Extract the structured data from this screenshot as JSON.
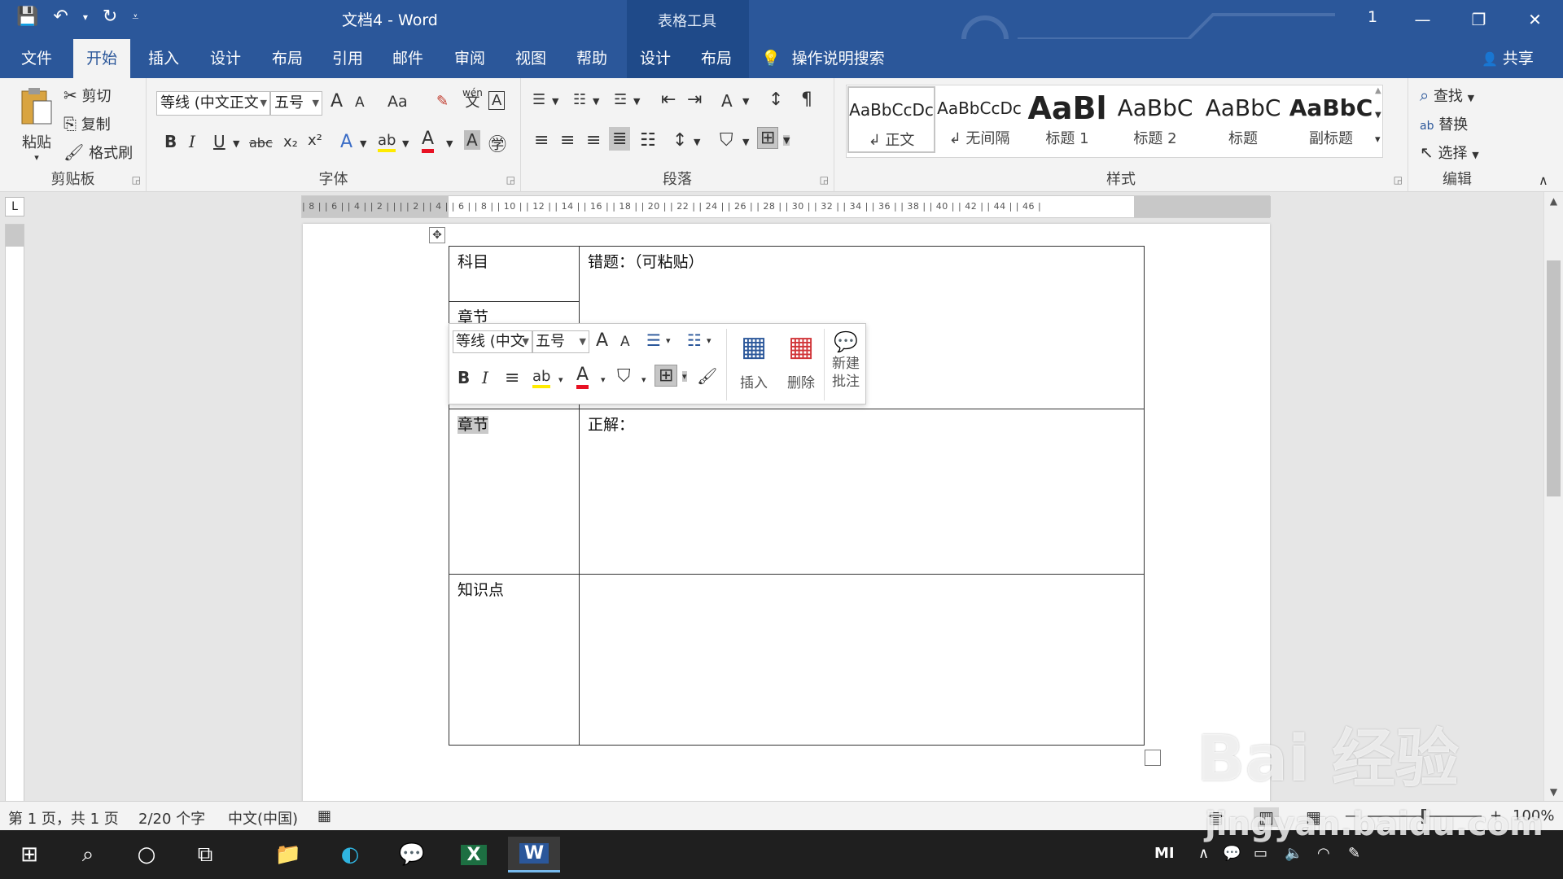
{
  "window": {
    "title": "文档4  -  Word",
    "context_label": "表格工具",
    "user_name": "1",
    "minimize": "—",
    "restore": "❐",
    "close": "✕"
  },
  "qat": {
    "save": "💾",
    "undo": "↶",
    "undo_dd": "▾",
    "redo": "↻",
    "customize": "⩡"
  },
  "tabs": {
    "items": [
      "文件",
      "开始",
      "插入",
      "设计",
      "布局",
      "引用",
      "邮件",
      "审阅",
      "视图",
      "帮助"
    ],
    "context_items": [
      "设计",
      "布局"
    ],
    "search_icon": "💡",
    "search": "操作说明搜索",
    "share_icon": "👤",
    "share": "共享",
    "active_index": 1
  },
  "ribbon": {
    "clipboard": {
      "paste": "粘贴",
      "paste_dd": "▾",
      "cut": "剪切",
      "copy": "复制",
      "format_painter": "格式刷",
      "label": "剪贴板"
    },
    "font": {
      "font_name": "等线 (中文正文",
      "font_size": "五号",
      "grow": "A",
      "shrink": "A",
      "change_case": "Aa",
      "clear": "✎",
      "phonetic": "wén",
      "phonetic_base": "文",
      "border_char": "A",
      "bold": "B",
      "italic": "I",
      "underline": "U",
      "strike": "abc",
      "subscript": "x₂",
      "superscript": "x²",
      "text_effect": "A",
      "highlight": "ab",
      "font_color": "A",
      "char_shade": "A",
      "enclose": "㊫",
      "label": "字体"
    },
    "paragraph": {
      "bullets": "☰",
      "numbering": "☷",
      "multilevel": "☲",
      "dec_indent": "⇤",
      "inc_indent": "⇥",
      "cjk": "A",
      "sort": "↕",
      "show_marks": "¶",
      "align_left": "≡",
      "align_center": "≡",
      "align_right": "≡",
      "justify": "≣",
      "distribute": "☷",
      "line_spacing": "↕",
      "shading": "⛉",
      "borders": "⊞",
      "label": "段落"
    },
    "styles": {
      "items": [
        {
          "sample": "AaBbCcDc",
          "name": "↲ 正文"
        },
        {
          "sample": "AaBbCcDc",
          "name": "↲ 无间隔"
        },
        {
          "sample": "AaBl",
          "name": "标题 1"
        },
        {
          "sample": "AaBbC",
          "name": "标题 2"
        },
        {
          "sample": "AaBbC",
          "name": "标题"
        },
        {
          "sample": "AaBbC",
          "name": "副标题"
        }
      ],
      "scroll_up": "▲",
      "scroll_down": "▼",
      "more": "▾",
      "label": "样式"
    },
    "editing": {
      "find": "查找",
      "find_icon": "⌕",
      "replace": "替换",
      "replace_icon": "ab",
      "select": "选择",
      "select_icon": "↖",
      "label": "编辑"
    },
    "collapse": "∧"
  },
  "ruler": {
    "ticks": "| 8 |   | 6 |   | 4 |   | 2 |   |   |   | 2 |   | 4 |   | 6 |   | 8 |   | 10 |   | 12 |  | 14 |  | 16 |  | 18 |  | 20 |  | 22 |  | 24 |  | 26 |  | 28 |  | 30 |  | 32 |  | 34 |  | 36 |  | 38 |  | 40 |  | 42 |  | 44 |  | 46 |",
    "tab_selector": "L"
  },
  "table": {
    "move_handle": "✥",
    "rows": [
      {
        "left": "科目",
        "right": "错题：（可粘贴）"
      },
      {
        "left": "章节",
        "right": ""
      },
      {
        "left": "章节",
        "right": "正解："
      },
      {
        "left": "知识点",
        "right": ""
      }
    ]
  },
  "mini_toolbar": {
    "font_name": "等线 (中文",
    "font_size": "五号",
    "grow": "A",
    "shrink": "A",
    "bullets": "☰",
    "numbering": "☷",
    "bold": "B",
    "italic": "I",
    "center": "≡",
    "highlight": "ab",
    "font_color": "A",
    "shading": "⛉",
    "borders": "⊞",
    "format_painter": "🖌",
    "insert_icon": "▦",
    "insert": "插入",
    "delete_icon": "▦",
    "delete": "删除",
    "comment_icon": "💬",
    "new_comment_line1": "新建",
    "new_comment_line2": "批注",
    "dd": "▾"
  },
  "status": {
    "page": "第 1 页，共 1 页",
    "words": "2/20 个字",
    "language": "中文(中国)",
    "macro": "▦",
    "views": [
      "▤",
      "▥",
      "▦"
    ],
    "zoom_minus": "—",
    "zoom_plus": "+",
    "zoom": "100%"
  },
  "taskbar": {
    "start": "⊞",
    "search": "⌕",
    "cortana": "○",
    "taskview": "⧉",
    "apps": [
      {
        "name": "file-explorer",
        "glyph": "📁"
      },
      {
        "name": "edge",
        "glyph": "◐"
      },
      {
        "name": "wechat",
        "glyph": "💬"
      },
      {
        "name": "excel",
        "glyph": "X"
      },
      {
        "name": "word",
        "glyph": "W"
      }
    ],
    "tray": {
      "mi": "MI",
      "chevron": "∧",
      "wechat": "💬",
      "battery": "▭",
      "volume": "🔈",
      "wifi": "◠",
      "pen": "✎"
    }
  },
  "watermark": {
    "main": "Bai 经验",
    "sub": "jingyan.baidu.com"
  },
  "colors": {
    "accent": "#2b579a",
    "font_color_bar": "#e81123"
  }
}
